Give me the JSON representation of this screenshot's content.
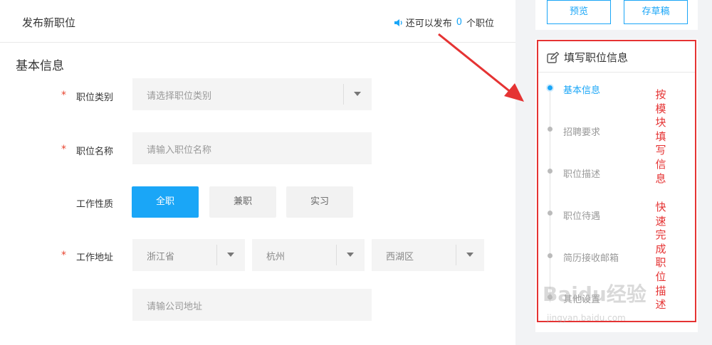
{
  "header": {
    "title": "发布新职位",
    "quota_prefix": "还可以发布",
    "quota_count": "0",
    "quota_suffix": "个职位"
  },
  "section": {
    "title": "基本信息"
  },
  "form": {
    "required_mark": "*",
    "category": {
      "label": "职位类别",
      "placeholder": "请选择职位类别"
    },
    "name": {
      "label": "职位名称",
      "placeholder": "请输入职位名称"
    },
    "nature": {
      "label": "工作性质",
      "options": [
        "全职",
        "兼职",
        "实习"
      ],
      "selected": "全职"
    },
    "location": {
      "label": "工作地址",
      "province": "浙江省",
      "city": "杭州",
      "district": "西湖区",
      "address_placeholder": "请输公司地址"
    }
  },
  "sidebar": {
    "preview_label": "预览",
    "draft_label": "存草稿",
    "panel_title": "填写职位信息",
    "steps": [
      "基本信息",
      "招聘要求",
      "职位描述",
      "职位待遇",
      "简历接收邮箱",
      "其他设置"
    ],
    "active_step": "基本信息"
  },
  "annotation": {
    "line1": "按模块填写信息",
    "line2": "快速完成职位描述",
    "color": "#e53333"
  },
  "watermark": {
    "main": "Baidu经验",
    "sub": "jingyan.baidu.com"
  },
  "colors": {
    "accent": "#1aa6f7",
    "required": "#e8442f",
    "annotation_red": "#e53333"
  },
  "icons": {
    "speaker": "speaker-icon",
    "edit": "edit-icon",
    "caret": "caret-down-icon"
  }
}
